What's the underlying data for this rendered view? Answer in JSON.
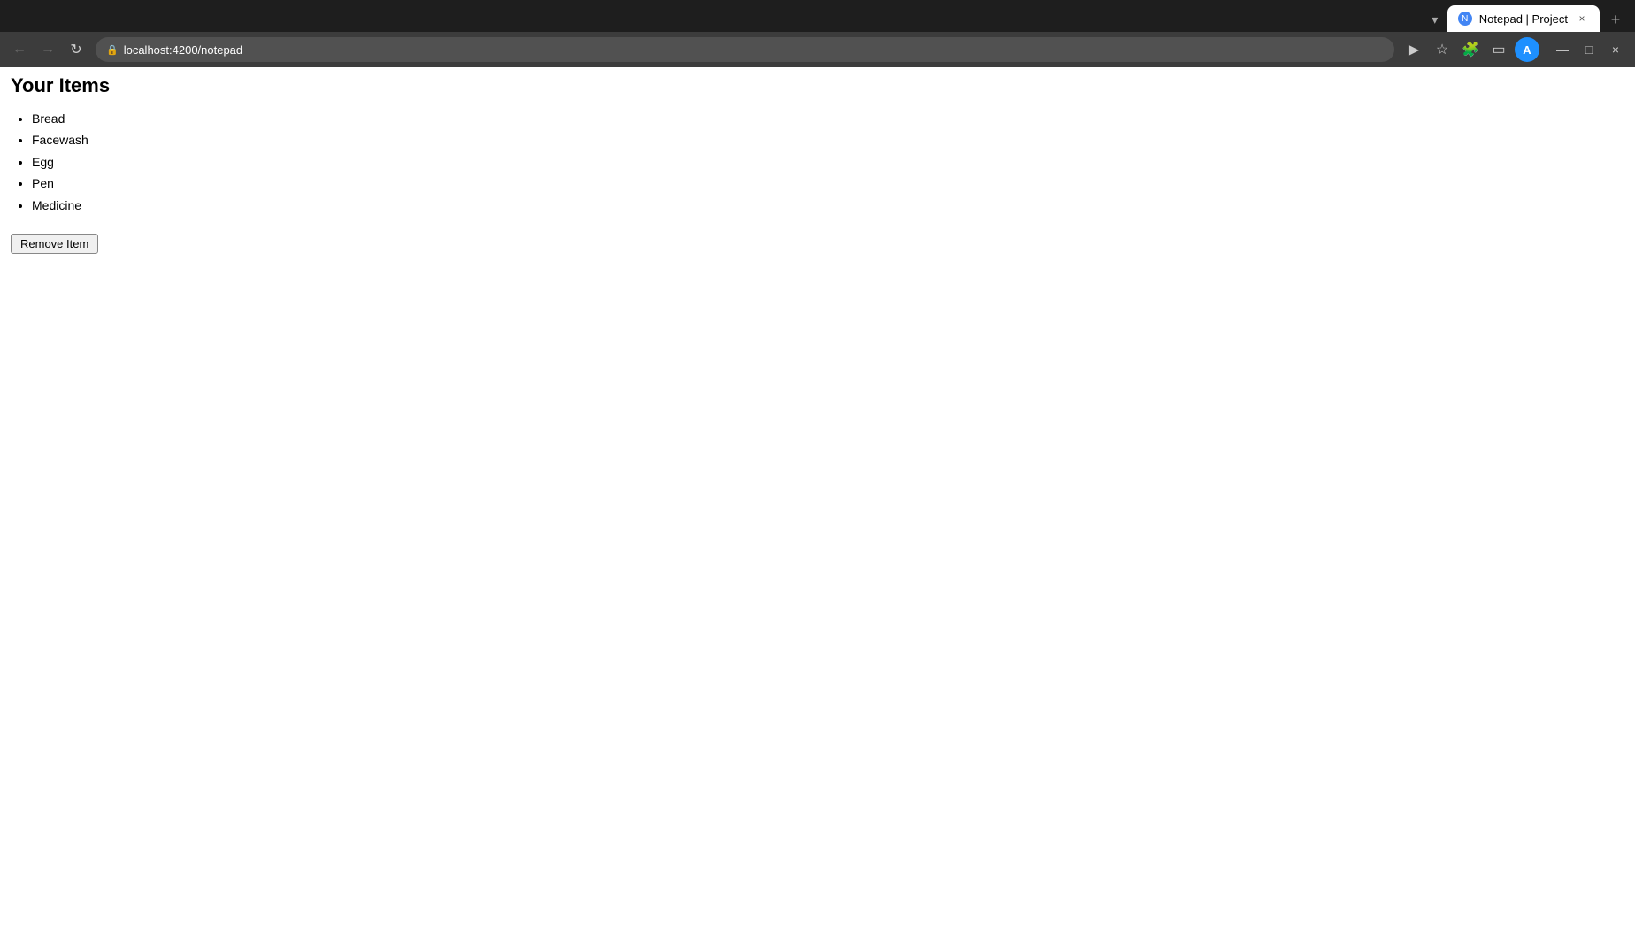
{
  "browser": {
    "tab": {
      "favicon_label": "N",
      "title": "Notepad | Project",
      "close_label": "×"
    },
    "new_tab_label": "+",
    "tab_list_label": "▾",
    "toolbar": {
      "back_label": "←",
      "forward_label": "→",
      "reload_label": "↻",
      "address": "localhost:4200/notepad",
      "media_btn_label": "▶",
      "bookmark_label": "☆",
      "extensions_label": "🧩",
      "sidebar_label": "▭",
      "profile_label": "A"
    },
    "window_controls": {
      "minimize_label": "—",
      "maximize_label": "□",
      "close_label": "×"
    }
  },
  "page": {
    "title": "Your Items",
    "items": [
      {
        "text": "Bread"
      },
      {
        "text": "Facewash"
      },
      {
        "text": "Egg"
      },
      {
        "text": "Pen"
      },
      {
        "text": "Medicine"
      }
    ],
    "remove_button_label": "Remove Item"
  }
}
